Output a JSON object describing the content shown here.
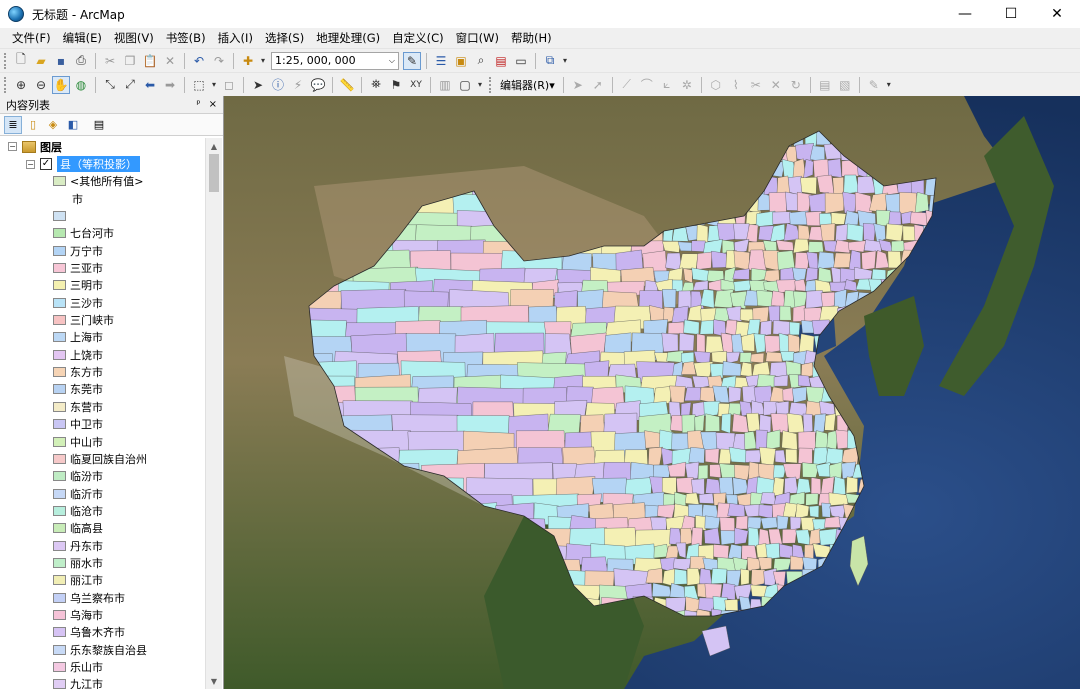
{
  "window": {
    "title": "无标题 - ArcMap",
    "minimize": "—",
    "maximize": "☐",
    "close": "✕"
  },
  "menu": [
    "文件(F)",
    "编辑(E)",
    "视图(V)",
    "书签(B)",
    "插入(I)",
    "选择(S)",
    "地理处理(G)",
    "自定义(C)",
    "窗口(W)",
    "帮助(H)"
  ],
  "toolbar": {
    "scale": "1:25, 000, 000",
    "editor_label": "编辑器(R)▾"
  },
  "toc": {
    "title": "内容列表",
    "pin": "ᵖ",
    "close": "×",
    "root_label": "图层",
    "layer_label": "县（等积投影）",
    "other_values_label": "<其他所有值>",
    "field_label": "市",
    "legend_items": [
      {
        "label": "",
        "color": "#cfe2f3"
      },
      {
        "label": "七台河市",
        "color": "#b6e8b0"
      },
      {
        "label": "万宁市",
        "color": "#b3d4f5"
      },
      {
        "label": "三亚市",
        "color": "#f7c6d6"
      },
      {
        "label": "三明市",
        "color": "#f4f0b0"
      },
      {
        "label": "三沙市",
        "color": "#b9e3f7"
      },
      {
        "label": "三门峡市",
        "color": "#f7c3c3"
      },
      {
        "label": "上海市",
        "color": "#bcd8f5"
      },
      {
        "label": "上饶市",
        "color": "#e3c6f2"
      },
      {
        "label": "东方市",
        "color": "#f6d4b5"
      },
      {
        "label": "东莞市",
        "color": "#b8d2f2"
      },
      {
        "label": "东营市",
        "color": "#f4ecc8"
      },
      {
        "label": "中卫市",
        "color": "#c9c6f4"
      },
      {
        "label": "中山市",
        "color": "#d2f0b8"
      },
      {
        "label": "临夏回族自治州",
        "color": "#f6c9c9"
      },
      {
        "label": "临汾市",
        "color": "#bfecc4"
      },
      {
        "label": "临沂市",
        "color": "#c6d8f6"
      },
      {
        "label": "临沧市",
        "color": "#b7eedd"
      },
      {
        "label": "临高县",
        "color": "#c8ecb8"
      },
      {
        "label": "丹东市",
        "color": "#dcc8f4"
      },
      {
        "label": "丽水市",
        "color": "#bfeec9"
      },
      {
        "label": "丽江市",
        "color": "#f1eeb5"
      },
      {
        "label": "乌兰察布市",
        "color": "#c3d0f6"
      },
      {
        "label": "乌海市",
        "color": "#f6c3d8"
      },
      {
        "label": "乌鲁木齐市",
        "color": "#d6c3f4"
      },
      {
        "label": "乐东黎族自治县",
        "color": "#c8daf6"
      },
      {
        "label": "乐山市",
        "color": "#f4c9e2"
      },
      {
        "label": "九江市",
        "color": "#e0cdf4"
      }
    ]
  },
  "map": {
    "ocean": "#1d3a6e",
    "land": "#6b6a3e",
    "desert": "#b8a47c",
    "polygon_palette": [
      "#c8b4f0",
      "#b4d4f4",
      "#f4c4d4",
      "#f4f0b4",
      "#c4f0c4",
      "#b4f0f0",
      "#f4d0b4",
      "#d4c4f4"
    ]
  }
}
